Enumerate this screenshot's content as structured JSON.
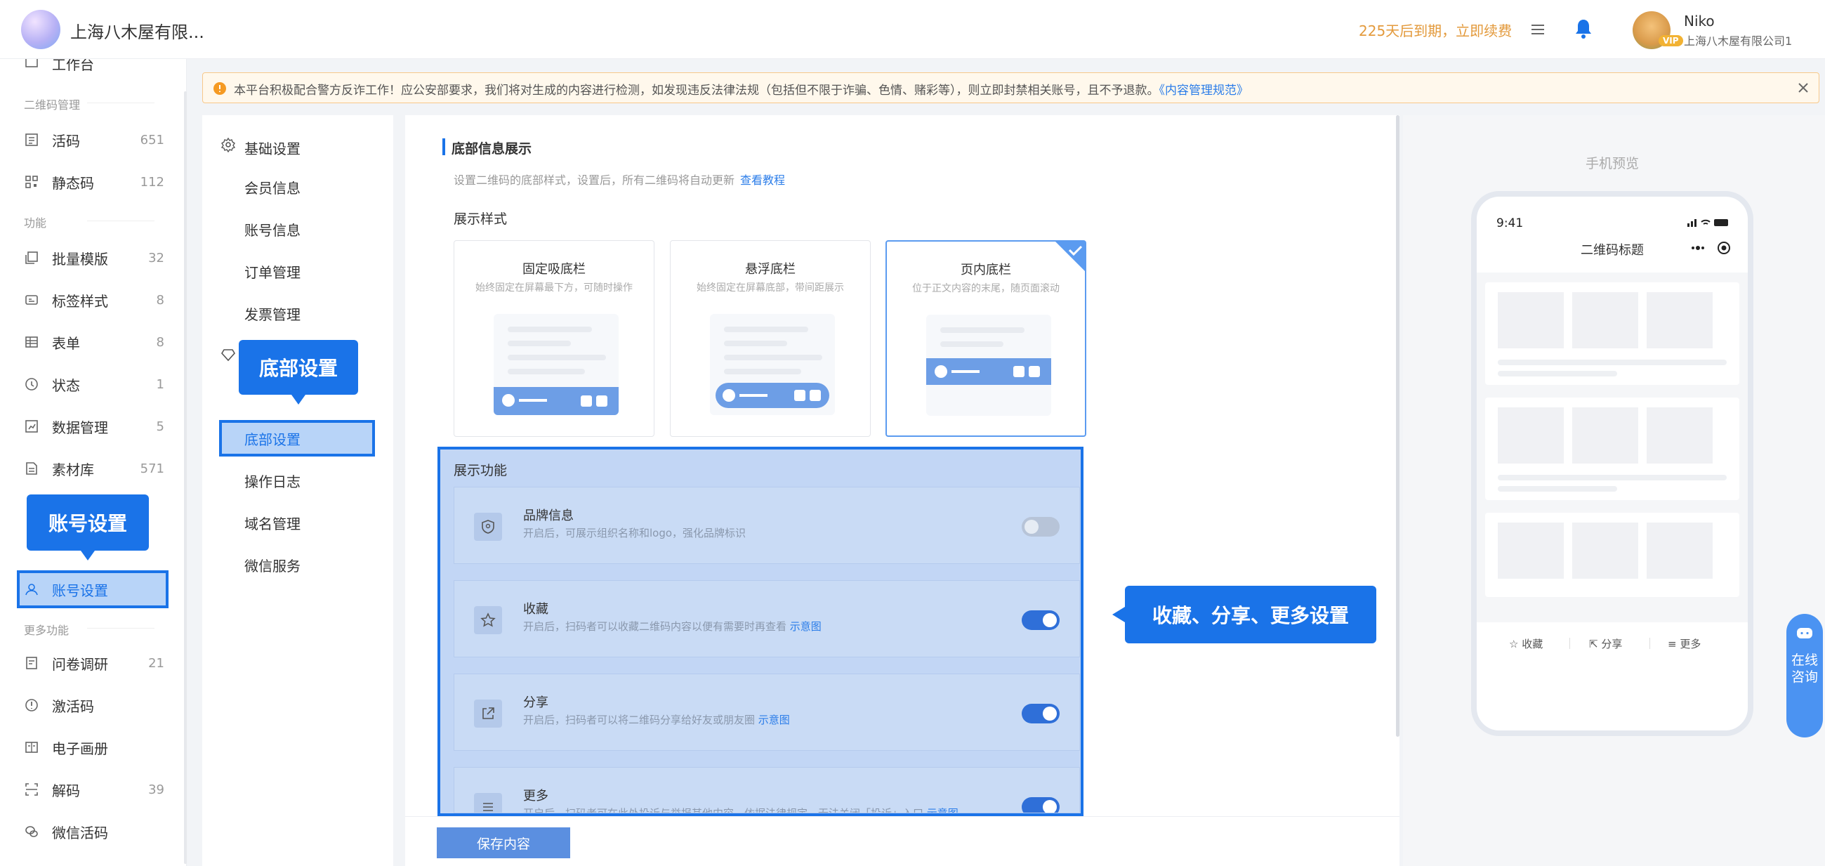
{
  "header": {
    "company": "上海八木屋有限...",
    "expire_notice": "225天后到期，立即续费",
    "user_name": "Niko",
    "user_company": "上海八木屋有限公司1",
    "vip_badge": "VIP"
  },
  "sidebar": {
    "top_cut": "工作台",
    "groups": {
      "qr": "二维码管理",
      "func": "功能",
      "more": "更多功能"
    },
    "items": [
      {
        "label": "活码",
        "count": "651",
        "icon": "live-code-icon"
      },
      {
        "label": "静态码",
        "count": "112",
        "icon": "static-code-icon"
      },
      {
        "label": "批量模版",
        "count": "32",
        "icon": "batch-template-icon"
      },
      {
        "label": "标签样式",
        "count": "8",
        "icon": "label-style-icon"
      },
      {
        "label": "表单",
        "count": "8",
        "icon": "form-icon"
      },
      {
        "label": "状态",
        "count": "1",
        "icon": "status-icon"
      },
      {
        "label": "数据管理",
        "count": "5",
        "icon": "data-icon"
      },
      {
        "label": "素材库",
        "count": "571",
        "icon": "material-icon"
      },
      {
        "label": "账号设置",
        "count": "",
        "icon": "user-icon"
      },
      {
        "label": "问卷调研",
        "count": "21",
        "icon": "survey-icon"
      },
      {
        "label": "激活码",
        "count": "",
        "icon": "activation-icon"
      },
      {
        "label": "电子画册",
        "count": "",
        "icon": "album-icon"
      },
      {
        "label": "解码",
        "count": "39",
        "icon": "decode-icon"
      },
      {
        "label": "微信活码",
        "count": "",
        "icon": "wechat-icon"
      }
    ]
  },
  "notice": {
    "text": "本平台积极配合警方反诈工作！应公安部要求，我们将对生成的内容进行检测，如发现违反法律法规（包括但不限于诈骗、色情、赌彩等），则立即封禁相关账号，且不予退款。",
    "link": "《内容管理规范》"
  },
  "settings_nav": {
    "group": "基础设置",
    "items": [
      "会员信息",
      "账号信息",
      "订单管理",
      "发票管理",
      "底部设置",
      "操作日志",
      "域名管理",
      "微信服务"
    ],
    "active": "底部设置"
  },
  "main": {
    "section_title": "底部信息展示",
    "section_desc": "设置二维码的底部样式，设置后，所有二维码将自动更新",
    "section_link": "查看教程",
    "style_label": "展示样式",
    "styles": [
      {
        "title": "固定吸底栏",
        "desc": "始终固定在屏幕最下方，可随时操作",
        "selected": false
      },
      {
        "title": "悬浮底栏",
        "desc": "始终固定在屏幕底部，带间距展示",
        "selected": false
      },
      {
        "title": "页内底栏",
        "desc": "位于正文内容的末尾，随页面滚动",
        "selected": true
      }
    ],
    "feature_label": "展示功能",
    "features": [
      {
        "title": "品牌信息",
        "desc": "开启后，可展示组织名称和logo，强化品牌标识",
        "link": "",
        "enabled": false,
        "icon": "brand-shield-icon"
      },
      {
        "title": "收藏",
        "desc": "开启后，扫码者可以收藏二维码内容以便有需要时再查看",
        "link": "示意图",
        "enabled": true,
        "icon": "star-icon"
      },
      {
        "title": "分享",
        "desc": "开启后，扫码者可以将二维码分享给好友或朋友圈",
        "link": "示意图",
        "enabled": true,
        "icon": "share-icon"
      },
      {
        "title": "更多",
        "desc": "开启后，扫码者可在此处投诉与举报其他内容，依据法律规定，无法关闭「投诉」入口",
        "link": "示意图",
        "enabled": true,
        "icon": "more-list-icon"
      }
    ],
    "save_label": "保存内容"
  },
  "preview": {
    "label": "手机预览",
    "time": "9:41",
    "title": "二维码标题",
    "actions": [
      "收藏",
      "分享",
      "更多"
    ]
  },
  "consult": "在线咨询",
  "callouts": {
    "footer": "底部设置",
    "account": "账号设置",
    "features": "收藏、分享、更多设置"
  },
  "colors": {
    "accent": "#1a73e8",
    "expire": "#e39a3c",
    "notice_bg": "#fff8ec"
  }
}
